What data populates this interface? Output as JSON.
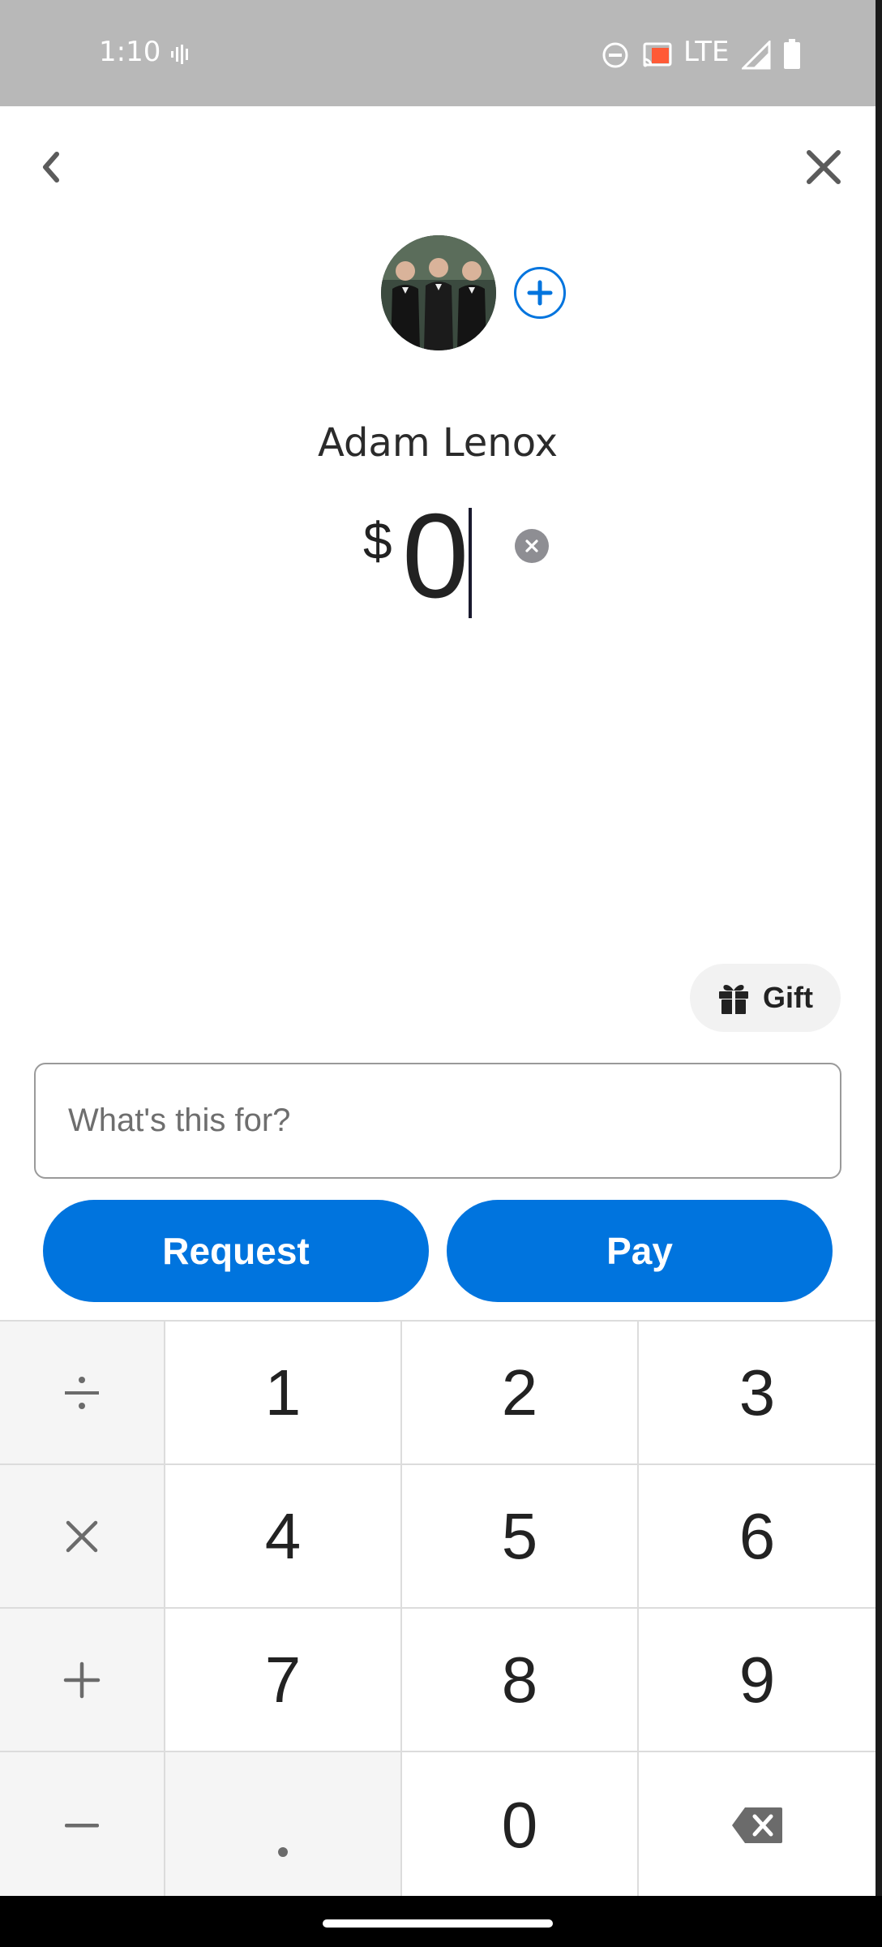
{
  "status_bar": {
    "time": "1:10",
    "network": "LTE",
    "icons": [
      "voicemail-icon",
      "do-not-disturb-icon",
      "cast-icon",
      "signal-icon",
      "battery-icon"
    ]
  },
  "header": {
    "back_icon": "chevron-left-icon",
    "close_icon": "close-icon"
  },
  "recipient": {
    "name": "Adam Lenox",
    "add_icon": "plus-icon"
  },
  "amount": {
    "currency": "$",
    "value": "0"
  },
  "gift": {
    "label": "Gift",
    "icon": "gift-icon"
  },
  "note": {
    "placeholder": "What's this for?",
    "value": ""
  },
  "actions": {
    "request_label": "Request",
    "pay_label": "Pay"
  },
  "keypad": {
    "operators": [
      "÷",
      "×",
      "+",
      "−"
    ],
    "rows": [
      [
        "1",
        "2",
        "3"
      ],
      [
        "4",
        "5",
        "6"
      ],
      [
        "7",
        "8",
        "9"
      ],
      [
        ".",
        "0",
        "backspace"
      ]
    ]
  },
  "colors": {
    "primary": "#0074de",
    "status_bar": "#b8b8b8",
    "cast_icon": "#ff5a36"
  }
}
